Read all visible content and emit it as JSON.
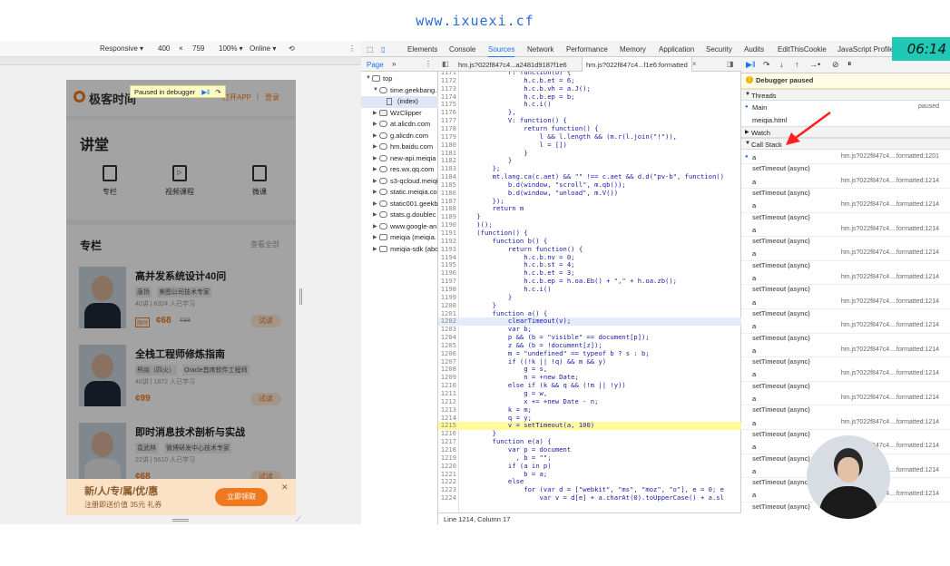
{
  "watermark": "www.ixuexi.cf",
  "device_toolbar": {
    "mode": "Responsive ▾",
    "width": "400",
    "times": "×",
    "height": "759",
    "zoom": "100% ▾",
    "network": "Online ▾"
  },
  "page": {
    "paused_label": "Paused in debugger",
    "logo_text": "极客时间",
    "open_app": "打开APP",
    "login": "登录",
    "section_title": "讲堂",
    "quick_links": [
      {
        "label": "专栏"
      },
      {
        "label": "视频课程"
      },
      {
        "label": "微课"
      }
    ],
    "courses_header": "专栏",
    "view_all": "查看全部",
    "courses": [
      {
        "title": "高并发系统设计40问",
        "author": "唐扬",
        "author_title": "美图公司技术专家",
        "meta": "40讲 | 6324 人已学习",
        "badge": "限时",
        "price": "¢68",
        "old_price": "¢99",
        "action": "试读"
      },
      {
        "title": "全栈工程师修炼指南",
        "author": "熊燚（四火）",
        "author_title": "Oracle首席软件工程师",
        "meta": "40讲 | 1872 人已学习",
        "badge": "",
        "price": "¢99",
        "old_price": "",
        "action": "试读"
      },
      {
        "title": "即时消息技术剖析与实战",
        "author": "袁武林",
        "author_title": "微博研发中心技术专家",
        "meta": "22讲 | 5610 人已学习",
        "badge": "",
        "price": "¢68",
        "old_price": "",
        "action": "试读"
      }
    ],
    "promo_title": "新/人/专/属/优/惠",
    "promo_sub": "注册即送价值 35元 礼券",
    "promo_button": "立即领取",
    "promo_close": "✕"
  },
  "devtools": {
    "tabs": [
      "Elements",
      "Console",
      "Sources",
      "Network",
      "Performance",
      "Memory",
      "Application",
      "Security",
      "Audits",
      "EditThisCookie",
      "JavaScript Profiler"
    ],
    "active_tab": "Sources",
    "navigator_tab": "Page",
    "tree": [
      {
        "label": "top",
        "depth": 0,
        "kind": "frame"
      },
      {
        "label": "time.geekbang.",
        "depth": 1,
        "kind": "cloud",
        "open": true
      },
      {
        "label": "(index)",
        "depth": 2,
        "kind": "file",
        "selected": true
      },
      {
        "label": "WzClipper",
        "depth": 1,
        "kind": "folder"
      },
      {
        "label": "at.alicdn.com",
        "depth": 1,
        "kind": "cloud"
      },
      {
        "label": "g.alicdn.com",
        "depth": 1,
        "kind": "cloud"
      },
      {
        "label": "hm.baidu.com",
        "depth": 1,
        "kind": "cloud"
      },
      {
        "label": "new-api.meiqia",
        "depth": 1,
        "kind": "cloud"
      },
      {
        "label": "res.wx.qq.com",
        "depth": 1,
        "kind": "cloud"
      },
      {
        "label": "s3-qcloud.meiqi",
        "depth": 1,
        "kind": "cloud"
      },
      {
        "label": "static.meiqia.co",
        "depth": 1,
        "kind": "cloud"
      },
      {
        "label": "static001.geekb",
        "depth": 1,
        "kind": "cloud"
      },
      {
        "label": "stats.g.doublec",
        "depth": 1,
        "kind": "cloud"
      },
      {
        "label": "www.google-an",
        "depth": 1,
        "kind": "cloud"
      },
      {
        "label": "meiqia (meiqia.",
        "depth": 1,
        "kind": "frame"
      },
      {
        "label": "meiqia-sdk (abc",
        "depth": 1,
        "kind": "frame"
      }
    ],
    "editor_tabs": [
      "hm.js?022f847c4...a2481d9187f1e6",
      "hm.js?022f847c4...f1e6:formatted"
    ],
    "code": [
      {
        "n": "1171",
        "t": "            r: function(b) {"
      },
      {
        "n": "1172",
        "t": "                h.c.b.et = 6;"
      },
      {
        "n": "1173",
        "t": "                h.c.b.vh = a.J();"
      },
      {
        "n": "1174",
        "t": "                h.c.b.ep = b;"
      },
      {
        "n": "1175",
        "t": "                h.c.i()"
      },
      {
        "n": "1176",
        "t": "            },"
      },
      {
        "n": "1177",
        "t": "            V: function() {"
      },
      {
        "n": "1178",
        "t": "                return function() {"
      },
      {
        "n": "1179",
        "t": "                    l && l.length && (m.r(l.join(\"!\")),"
      },
      {
        "n": "1180",
        "t": "                    l = [])"
      },
      {
        "n": "1181",
        "t": "                }"
      },
      {
        "n": "1182",
        "t": "            }"
      },
      {
        "n": "1183",
        "t": "        };"
      },
      {
        "n": "1184",
        "t": "        mt.lang.ca(c.aet) && \"\" !== c.aet && d.d(\"pv-b\", function()"
      },
      {
        "n": "1185",
        "t": "            b.d(window, \"scroll\", m.qb());"
      },
      {
        "n": "1186",
        "t": "            b.d(window, \"unload\", m.V())"
      },
      {
        "n": "1187",
        "t": "        });"
      },
      {
        "n": "1188",
        "t": "        return m"
      },
      {
        "n": "1189",
        "t": "    }"
      },
      {
        "n": "1190",
        "t": "    )();"
      },
      {
        "n": "1191",
        "t": "    (function() {"
      },
      {
        "n": "1192",
        "t": "        function b() {"
      },
      {
        "n": "1193",
        "t": "            return function() {"
      },
      {
        "n": "1194",
        "t": "                h.c.b.nv = 0;"
      },
      {
        "n": "1195",
        "t": "                h.c.b.st = 4;"
      },
      {
        "n": "1196",
        "t": "                h.c.b.et = 3;"
      },
      {
        "n": "1197",
        "t": "                h.c.b.ep = h.oa.Eb() + \",\" + h.oa.zb();"
      },
      {
        "n": "1198",
        "t": "                h.c.i()"
      },
      {
        "n": "1199",
        "t": "            }"
      },
      {
        "n": "1200",
        "t": "        }"
      },
      {
        "n": "1201",
        "t": "        function a() {"
      },
      {
        "n": "1202",
        "t": "            clearTimeout(v);",
        "hl": "blue"
      },
      {
        "n": "1203",
        "t": "            var b;"
      },
      {
        "n": "1204",
        "t": "            p && (b = \"visible\" == document[p]);"
      },
      {
        "n": "1205",
        "t": "            z && (b = !document[z]);"
      },
      {
        "n": "1206",
        "t": "            m = \"undefined\" == typeof b ? s : b;"
      },
      {
        "n": "1207",
        "t": "            if ((!k || !q) && m && y)"
      },
      {
        "n": "1208",
        "t": "                g = s,"
      },
      {
        "n": "1209",
        "t": "                n = +new Date;"
      },
      {
        "n": "1210",
        "t": "            else if (k && q && (!m || !y))"
      },
      {
        "n": "1211",
        "t": "                g = w,"
      },
      {
        "n": "1212",
        "t": "                x += +new Date - n;"
      },
      {
        "n": "1213",
        "t": "            k = m;"
      },
      {
        "n": "1214",
        "t": "            q = y;"
      },
      {
        "n": "1215",
        "t": "            v = setTimeout(a, 100)",
        "hl": "yellow"
      },
      {
        "n": "1216",
        "t": "        }"
      },
      {
        "n": "1217",
        "t": "        function e(a) {"
      },
      {
        "n": "1218",
        "t": "            var p = document"
      },
      {
        "n": "1219",
        "t": "              , b = \"\";"
      },
      {
        "n": "1220",
        "t": "            if (a in p)"
      },
      {
        "n": "1221",
        "t": "                b = a;"
      },
      {
        "n": "1222",
        "t": "            else"
      },
      {
        "n": "1223",
        "t": "                for (var d = [\"webkit\", \"ms\", \"moz\", \"o\"], e = 0; e"
      },
      {
        "n": "1224",
        "t": "                    var v = d[e] + a.charAt(0).toUpperCase() + a.sl"
      }
    ],
    "status": "Line 1214, Column 17",
    "paused_title": "Debugger paused",
    "threads_label": "Threads",
    "threads": [
      {
        "name": "Main",
        "state": "paused"
      },
      {
        "name": "meiqia.html",
        "state": ""
      }
    ],
    "watch_label": "Watch",
    "callstack_label": "Call Stack",
    "callstack": [
      {
        "fn": "a",
        "loc": "hm.js?022f847c4....formatted:1201",
        "async": ""
      },
      {
        "fn": "a",
        "loc": "hm.js?022f847c4....formatted:1214",
        "async": "setTimeout (async)"
      },
      {
        "fn": "a",
        "loc": "hm.js?022f847c4....formatted:1214",
        "async": "setTimeout (async)"
      },
      {
        "fn": "a",
        "loc": "hm.js?022f847c4....formatted:1214",
        "async": "setTimeout (async)"
      },
      {
        "fn": "a",
        "loc": "hm.js?022f847c4....formatted:1214",
        "async": "setTimeout (async)"
      },
      {
        "fn": "a",
        "loc": "hm.js?022f847c4....formatted:1214",
        "async": "setTimeout (async)"
      },
      {
        "fn": "a",
        "loc": "hm.js?022f847c4....formatted:1214",
        "async": "setTimeout (async)"
      },
      {
        "fn": "a",
        "loc": "hm.js?022f847c4....formatted:1214",
        "async": "setTimeout (async)"
      },
      {
        "fn": "a",
        "loc": "hm.js?022f847c4....formatted:1214",
        "async": "setTimeout (async)"
      },
      {
        "fn": "a",
        "loc": "hm.js?022f847c4....formatted:1214",
        "async": "setTimeout (async)"
      },
      {
        "fn": "a",
        "loc": "hm.js?022f847c4....formatted:1214",
        "async": "setTimeout (async)"
      },
      {
        "fn": "a",
        "loc": "hm.js?022f847c4....formatted:1214",
        "async": "setTimeout (async)"
      },
      {
        "fn": "a",
        "loc": "hm.js?022f847c4....formatted:1214",
        "async": "setTimeout (async)"
      },
      {
        "fn": "a",
        "loc": "hm.js?022f847c4....formatted:1214",
        "async": "setTimeout (async)"
      },
      {
        "fn": "a",
        "loc": "hm.js?022f847c4....formatted:1214",
        "async": "setTimeout (async)"
      },
      {
        "fn": "a",
        "loc": "",
        "async": "setTimeout (async)"
      }
    ]
  },
  "clock": "06:14",
  "colors": {
    "accent": "#1a73e8",
    "brand_orange": "#f0791f",
    "paused_bg": "#fffbe4",
    "exec_line": "#fffb9c",
    "arrow_red": "#ff1f1f",
    "clock_bg": "#1fc9b5"
  }
}
